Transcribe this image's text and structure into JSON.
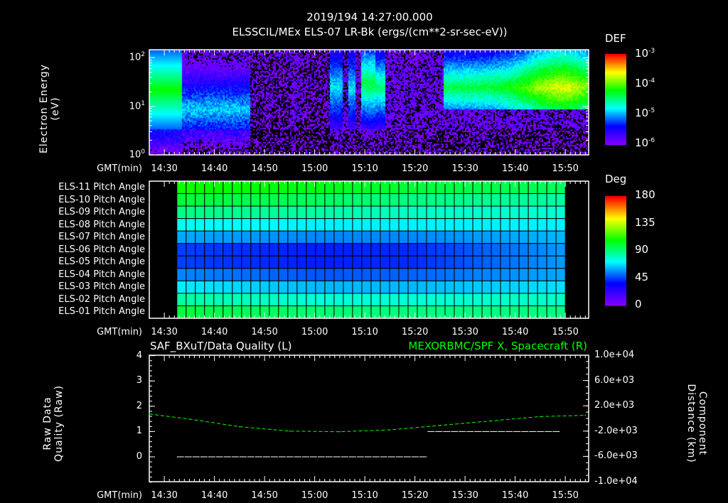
{
  "header": {
    "datetime": "2019/194 14:27:00.000"
  },
  "chart_data": [
    {
      "type": "heatmap",
      "title": "ELSSCIL/MEx ELS-07 LR-Bk  (ergs/(cm**2-sr-sec-eV))",
      "xlabel": "GMT(min)",
      "ylabel": "Electron Energy (eV)",
      "xlim": [
        "14:27",
        "15:54"
      ],
      "xticks": [
        "14:30",
        "14:40",
        "14:50",
        "15:00",
        "15:10",
        "15:20",
        "15:30",
        "15:40",
        "15:50"
      ],
      "ylim": [
        1,
        150
      ],
      "yscale": "log",
      "yticks": [
        "10^0",
        "10^1",
        "10^2"
      ],
      "colorbar": {
        "label": "DEF",
        "scale": "log",
        "range": [
          1e-06,
          0.001
        ],
        "ticks": [
          "10^-3",
          "10^-4",
          "10^-5",
          "10^-6"
        ]
      },
      "colormap": [
        "#7f00ff",
        "#0000ff",
        "#00ffff",
        "#00ff00",
        "#ffff00",
        "#ff0000"
      ]
    },
    {
      "type": "heatmap",
      "xlabel": "GMT(min)",
      "xlim": [
        "14:27",
        "15:54"
      ],
      "xticks": [
        "14:30",
        "14:40",
        "14:50",
        "15:00",
        "15:10",
        "15:20",
        "15:30",
        "15:40",
        "15:50"
      ],
      "data_time_range": [
        "14:32:30",
        "15:50:00"
      ],
      "rows": [
        "ELS-11 Pitch Angle",
        "ELS-10 Pitch Angle",
        "ELS-09 Pitch Angle",
        "ELS-08 Pitch Angle",
        "ELS-07 Pitch Angle",
        "ELS-06 Pitch Angle",
        "ELS-05 Pitch Angle",
        "ELS-04 Pitch Angle",
        "ELS-03 Pitch Angle",
        "ELS-02 Pitch Angle",
        "ELS-01 Pitch Angle"
      ],
      "sample_times": [
        "14:32",
        "15:00",
        "15:20",
        "15:50"
      ],
      "values_deg": [
        [
          110,
          105,
          100,
          95
        ],
        [
          100,
          95,
          90,
          85
        ],
        [
          90,
          85,
          80,
          78
        ],
        [
          75,
          70,
          70,
          70
        ],
        [
          60,
          55,
          55,
          62
        ],
        [
          45,
          40,
          42,
          58
        ],
        [
          45,
          40,
          42,
          58
        ],
        [
          55,
          48,
          50,
          60
        ],
        [
          70,
          62,
          62,
          68
        ],
        [
          85,
          78,
          78,
          80
        ],
        [
          100,
          92,
          90,
          90
        ]
      ],
      "colorbar": {
        "label": "Deg",
        "range": [
          0,
          180
        ],
        "ticks": [
          "180",
          "135",
          "90",
          "45",
          "0"
        ]
      }
    },
    {
      "type": "line",
      "title_left": "SAF_BXuT/Data Quality (L)",
      "title_right": "MEXORBMC/SPF X, Spacecraft (R)",
      "xlabel": "GMT(min)",
      "xlim": [
        "14:27",
        "15:54"
      ],
      "xticks": [
        "14:30",
        "14:40",
        "14:50",
        "15:00",
        "15:10",
        "15:20",
        "15:30",
        "15:40",
        "15:50"
      ],
      "ylabel_left": "Raw Data Quality (Raw)",
      "ylim_left": [
        -1,
        4
      ],
      "yticks_left": [
        "4",
        "3",
        "2",
        "1",
        "0"
      ],
      "ylabel_right": "Component Distance (km)",
      "ylim_right": [
        -10000,
        10000
      ],
      "yticks_right": [
        "1.0e+04",
        "6.0e+03",
        "2.0e+03",
        "-2.0e+03",
        "-6.0e+03",
        "-1.0e+04"
      ],
      "series": [
        {
          "name": "SAF_BXuT/Data Quality",
          "axis": "left",
          "color": "#ffffff",
          "segments": [
            {
              "x": [
                "14:32:30",
                "15:22:30"
              ],
              "y": [
                0,
                0
              ]
            },
            {
              "x": [
                "15:22:30",
                "15:49:00"
              ],
              "y": [
                1,
                1
              ]
            }
          ]
        },
        {
          "name": "MEXORBMC/SPF X, Spacecraft",
          "axis": "right",
          "color": "#00ff00",
          "x": [
            "14:27",
            "14:35",
            "14:45",
            "14:55",
            "15:05",
            "15:15",
            "15:25",
            "15:35",
            "15:45",
            "15:54"
          ],
          "y": [
            700,
            -100,
            -1300,
            -2000,
            -2100,
            -1800,
            -1100,
            -400,
            300,
            500
          ]
        }
      ]
    }
  ]
}
